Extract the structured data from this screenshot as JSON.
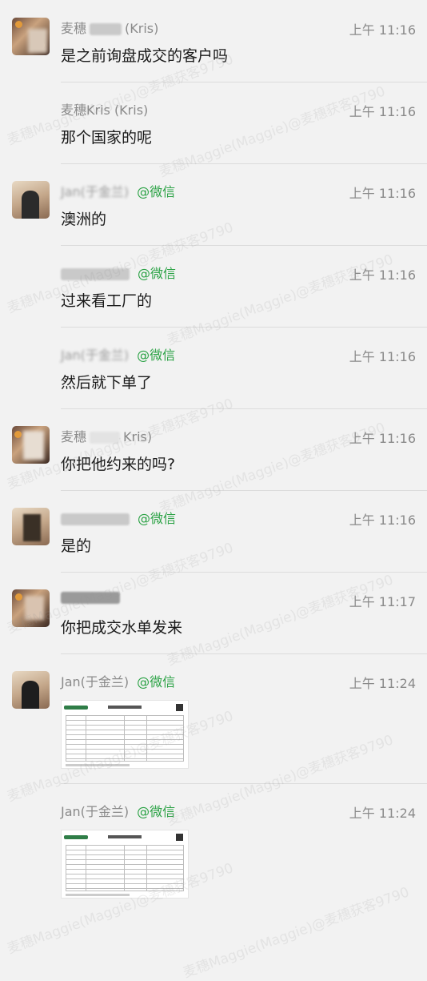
{
  "wechat_suffix": "@微信",
  "messages": [
    {
      "name": "麦穗",
      "name_tail": "(Kris)",
      "time": "上午 11:16",
      "text": "是之前询盘成交的客户吗"
    },
    {
      "name": "麦穗Kris (Kris)",
      "time": "上午 11:16",
      "text": "那个国家的呢"
    },
    {
      "name": "Jan(于金兰)",
      "time": "上午 11:16",
      "text": "澳洲的"
    },
    {
      "time": "上午 11:16",
      "text": "过来看工厂的"
    },
    {
      "name": "Jan(于金兰)",
      "time": "上午 11:16",
      "text": "然后就下单了"
    },
    {
      "name": "麦穗",
      "name_tail": "Kris)",
      "time": "上午 11:16",
      "text": "你把他约来的吗?"
    },
    {
      "time": "上午 11:16",
      "text": "是的"
    },
    {
      "time": "上午 11:17",
      "text": "你把成交水单发来"
    },
    {
      "name": "Jan(于金兰)",
      "time": "上午 11:24"
    },
    {
      "name": "Jan(于金兰)",
      "time": "上午 11:24"
    }
  ],
  "watermark": "麦穗Maggie(Maggie)@麦穗获客9790"
}
